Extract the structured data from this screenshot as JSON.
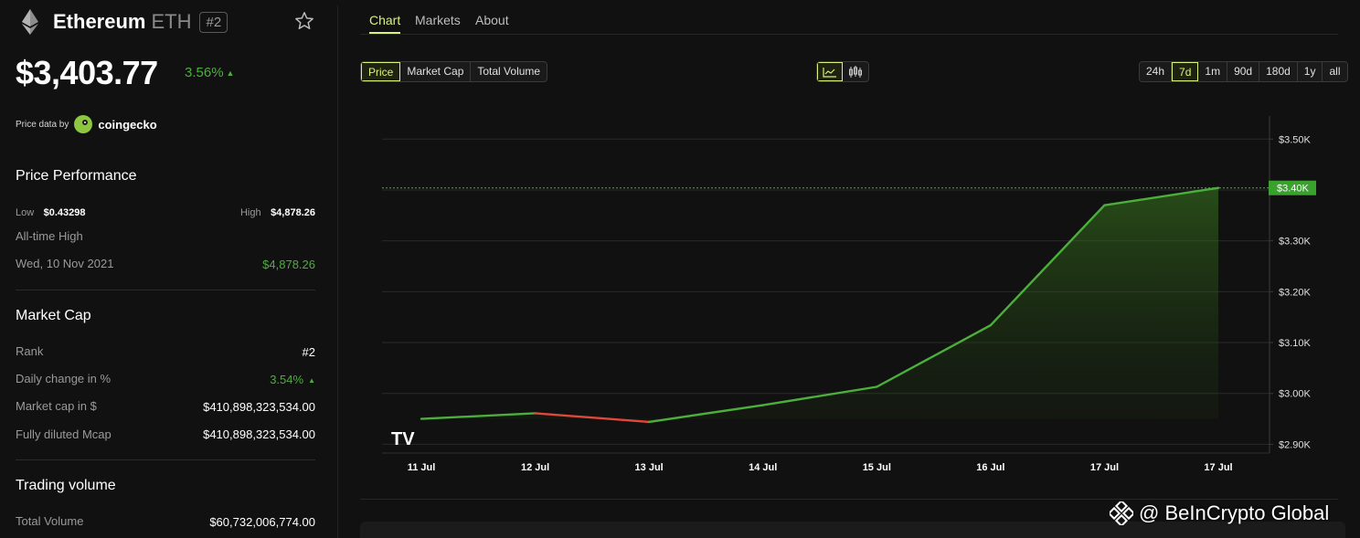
{
  "coin": {
    "name": "Ethereum",
    "symbol": "ETH",
    "rank_badge": "#2",
    "price": "$3,403.77",
    "change": "3.56%"
  },
  "price_data": {
    "label": "Price data by",
    "provider": "coingecko"
  },
  "performance": {
    "title": "Price Performance",
    "low_label": "Low",
    "low_value": "$0.43298",
    "high_label": "High",
    "high_value": "$4,878.26",
    "ath_label": "All-time High",
    "ath_date": "Wed, 10 Nov 2021",
    "ath_value": "$4,878.26"
  },
  "market_cap": {
    "title": "Market Cap",
    "rows": [
      {
        "label": "Rank",
        "value": "#2"
      },
      {
        "label": "Daily change in %",
        "value": "3.54%"
      },
      {
        "label": "Market cap in $",
        "value": "$410,898,323,534.00"
      },
      {
        "label": "Fully diluted Mcap",
        "value": "$410,898,323,534.00"
      }
    ]
  },
  "trading_volume": {
    "title": "Trading volume",
    "rows": [
      {
        "label": "Total Volume",
        "value": "$60,732,006,774.00"
      }
    ]
  },
  "tabs": [
    {
      "label": "Chart",
      "active": true
    },
    {
      "label": "Markets",
      "active": false
    },
    {
      "label": "About",
      "active": false
    }
  ],
  "metric_buttons": [
    {
      "label": "Price",
      "active": true
    },
    {
      "label": "Market Cap",
      "active": false
    },
    {
      "label": "Total Volume",
      "active": false
    }
  ],
  "chart_type_buttons": [
    {
      "icon": "line-chart-icon",
      "active": true
    },
    {
      "icon": "candlestick-icon",
      "active": false
    }
  ],
  "range_buttons": [
    {
      "label": "24h",
      "active": false
    },
    {
      "label": "7d",
      "active": true
    },
    {
      "label": "1m",
      "active": false
    },
    {
      "label": "90d",
      "active": false
    },
    {
      "label": "180d",
      "active": false
    },
    {
      "label": "1y",
      "active": false
    },
    {
      "label": "all",
      "active": false
    }
  ],
  "colors": {
    "accent": "#d8f27a",
    "up": "#4caf3c",
    "down": "#e0483c",
    "background": "#111111"
  },
  "watermark": "@ BeInCrypto Global",
  "chart_data": {
    "type": "area",
    "x": [
      "11 Jul",
      "12 Jul",
      "13 Jul",
      "14 Jul",
      "15 Jul",
      "16 Jul",
      "17 Jul",
      "17 Jul"
    ],
    "values": [
      2950,
      2961,
      2944,
      2977,
      3013,
      3134,
      3370,
      3404
    ],
    "yticks": [
      "$3.50K",
      "$3.40K",
      "$3.30K",
      "$3.20K",
      "$3.10K",
      "$3.00K",
      "$2.90K"
    ],
    "ytick_values": [
      3500,
      3400,
      3300,
      3200,
      3100,
      3000,
      2900
    ],
    "current_label": "$3.40K",
    "current_value": 3404,
    "ylim": [
      2890,
      3540
    ],
    "grid": true
  }
}
